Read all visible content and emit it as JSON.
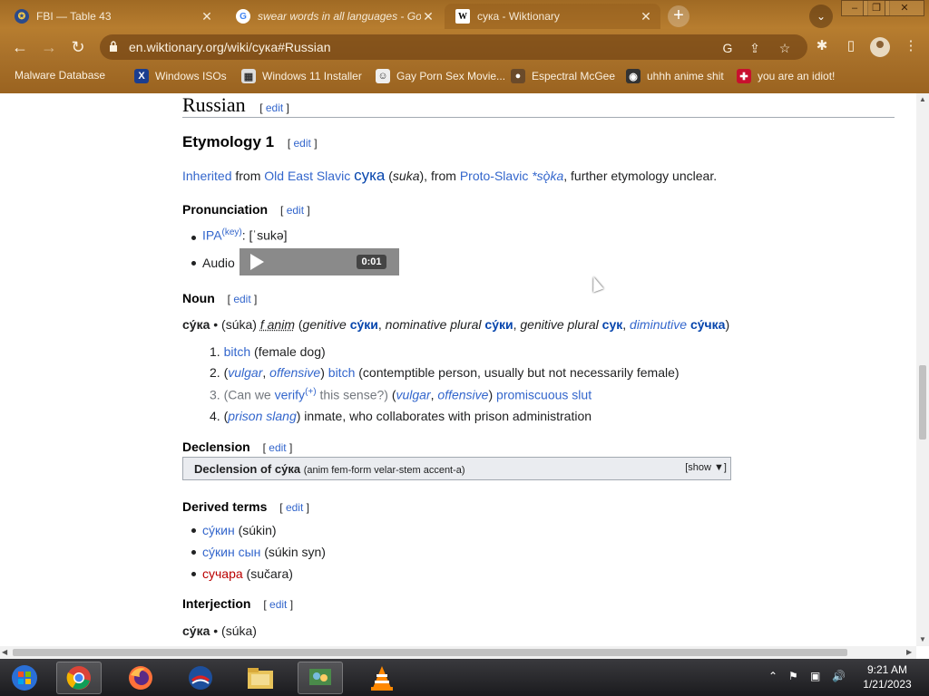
{
  "tabs": [
    {
      "title": "FBI — Table 43"
    },
    {
      "title": "swear words in all languages - Goo"
    },
    {
      "title": "сука - Wiktionary",
      "icon_text": "W"
    }
  ],
  "toolbar": {
    "url": "en.wiktionary.org/wiki/сука#Russian"
  },
  "bookmarks": [
    {
      "label": "Malware Database"
    },
    {
      "label": "Windows ISOs"
    },
    {
      "label": "Windows 11 Installer"
    },
    {
      "label": "Gay Porn Sex Movie..."
    },
    {
      "label": "Espectral McGee"
    },
    {
      "label": "uhhh anime shit"
    },
    {
      "label": "you are an idiot!"
    }
  ],
  "article": {
    "lang_heading": "Russian",
    "edit": "edit",
    "etymology_heading": "Etymology 1",
    "etym": {
      "inherited": "Inherited",
      "from1": " from ",
      "oes": "Old East Slavic",
      "sp": " ",
      "oes_word": "сука",
      "paren1": " (",
      "oes_translit": "suka",
      "from2": "), from ",
      "ps": "Proto-Slavic",
      "ps_word": "*sǫ̀ka",
      "rest": ", further etymology unclear."
    },
    "pron_heading": "Pronunciation",
    "ipa_label": "IPA",
    "ipa_key": "(key)",
    "ipa_value": ": [ˈsukə]",
    "audio_label": "Audio",
    "audio_time": "0:01",
    "noun_heading": "Noun",
    "headword": {
      "word": "су́ка",
      "sep": " • (",
      "translit": "súka",
      "gender": "f anim",
      "p1": " (",
      "gen_label": "genitive",
      "gen_word": "су́ки",
      "nom_label": "nominative plural",
      "nom_word": "су́ки",
      "genpl_label": "genitive plural",
      "genpl_word": "сук",
      "dim_label": "diminutive",
      "dim_word": "су́чка",
      "close": ")"
    },
    "senses": [
      {
        "num": "1.",
        "link": "bitch",
        "rest": " (female dog)"
      },
      {
        "num": "2.",
        "q1": "vulgar",
        "q2": "offensive",
        "link": "bitch",
        "rest": " (contemptible person, usually but not necessarily female)"
      },
      {
        "num": "3.",
        "pre": "(Can we ",
        "verify": "verify",
        "sup": "(+)",
        "post": " this sense?) ",
        "q1": "vulgar",
        "q2": "offensive",
        "link1": "promiscuous",
        "link2": "slut"
      },
      {
        "num": "4.",
        "q1": "prison slang",
        "rest": " inmate, who collaborates with prison administration"
      }
    ],
    "declension_heading": "Declension",
    "declension_box": {
      "title": "Declension of ",
      "word": "су́ка",
      "sub": "(anim fem-form velar-stem accent-a)",
      "show": "[show ▼]"
    },
    "derived_heading": "Derived terms",
    "derived": [
      {
        "word": "су́кин",
        "translit": "(súkin)"
      },
      {
        "word": "су́кин сын",
        "translit": "(súkin syn)"
      },
      {
        "word": "сучара",
        "translit": "(sučara)"
      }
    ],
    "interjection_heading": "Interjection",
    "interj_word": "су́ка",
    "interj_translit": " • (súka)"
  },
  "clock": {
    "time": "9:21 AM",
    "date": "1/21/2023"
  },
  "colors": {
    "link": "#3366cc",
    "redlink": "#ba0000",
    "chrome": "#a9712a"
  },
  "icons": {
    "tab_fav_1": "fbi-seal-icon",
    "tab_fav_2": "google-icon",
    "tab_fav_3": "wiktionary-icon"
  }
}
